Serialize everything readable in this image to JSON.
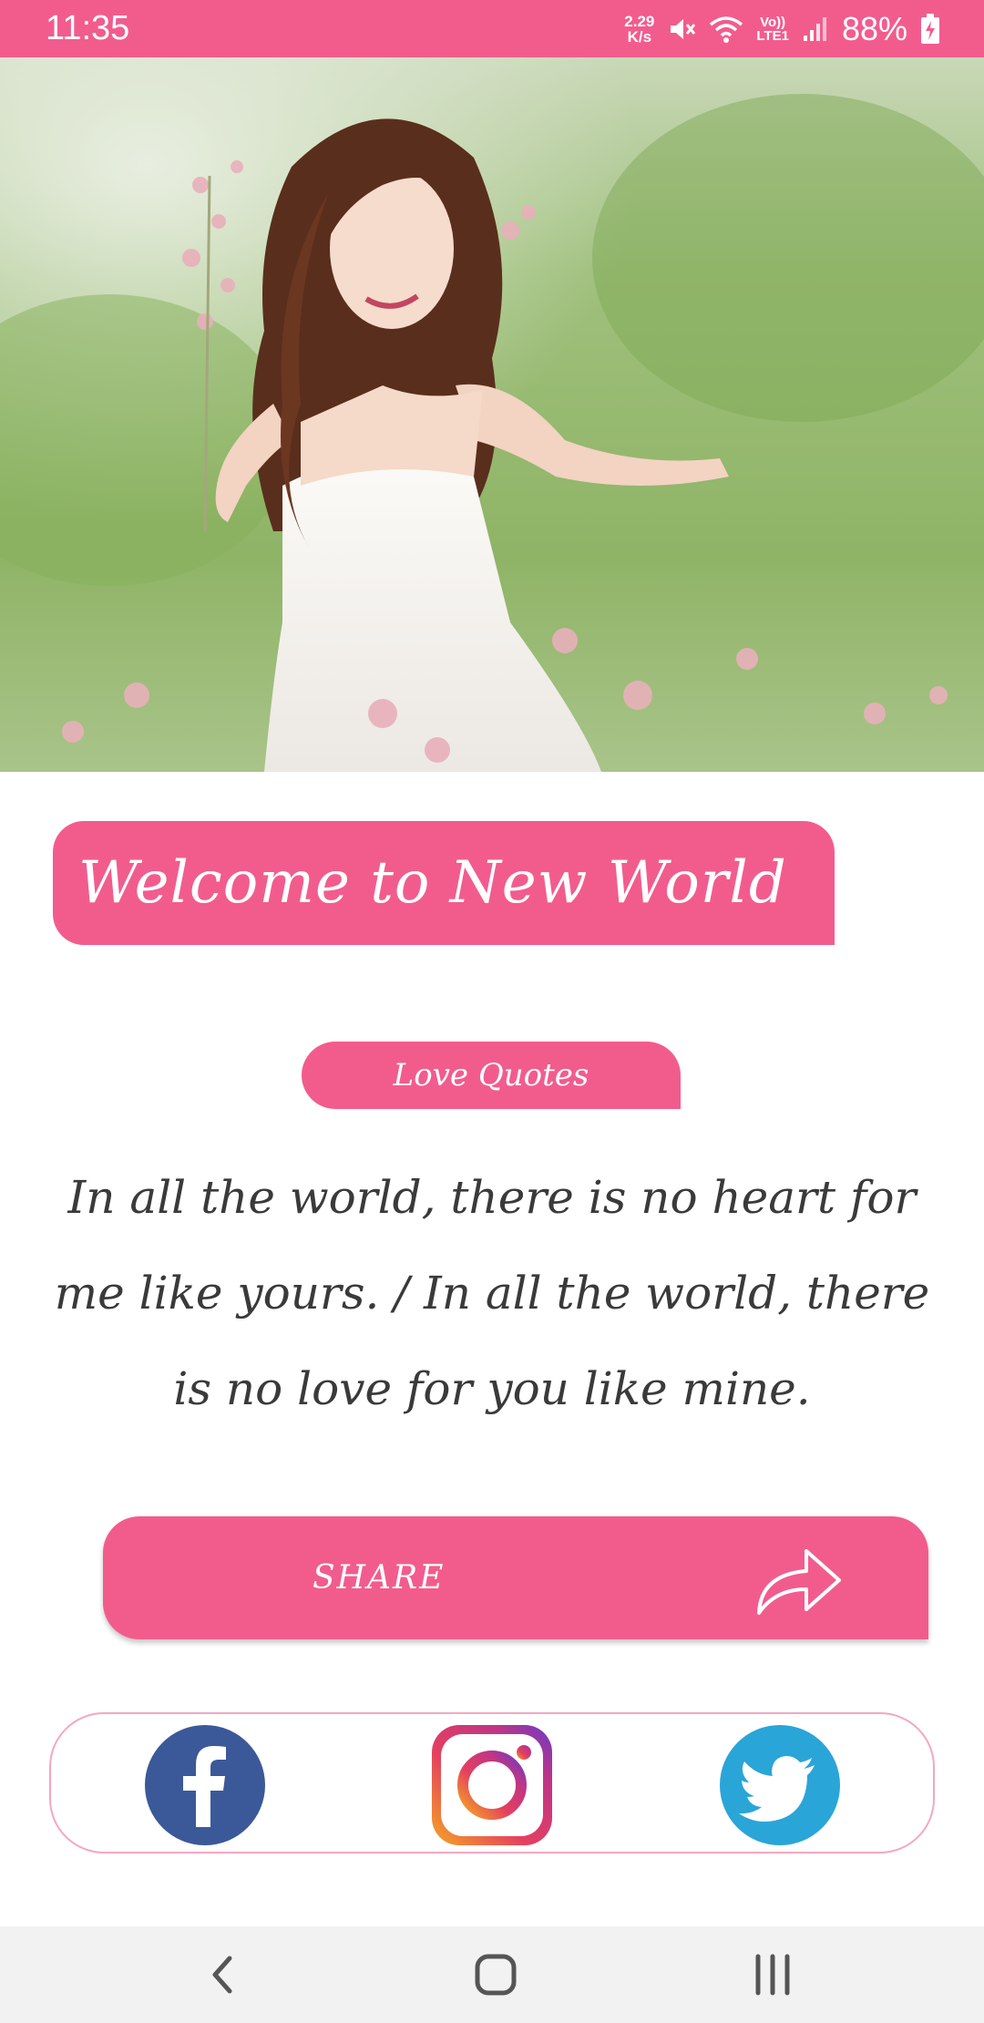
{
  "status_bar": {
    "time": "11:35",
    "net_speed_value": "2.29",
    "net_speed_unit": "K/s",
    "lte_top": "Vo))",
    "lte_bottom": "LTE1",
    "battery": "88%"
  },
  "content": {
    "welcome_title": "Welcome to New World",
    "category": "Love Quotes",
    "quote": "In all the world, there is no heart for me like yours. / In all the world, there is no love for you like mine.",
    "share_label": "SHARE"
  },
  "social": {
    "items": [
      "facebook-icon",
      "instagram-icon",
      "twitter-icon"
    ]
  },
  "colors": {
    "accent": "#f25c8d",
    "panel_border": "#f3a7c3",
    "facebook": "#3b5998",
    "twitter": "#2aa5d8"
  }
}
